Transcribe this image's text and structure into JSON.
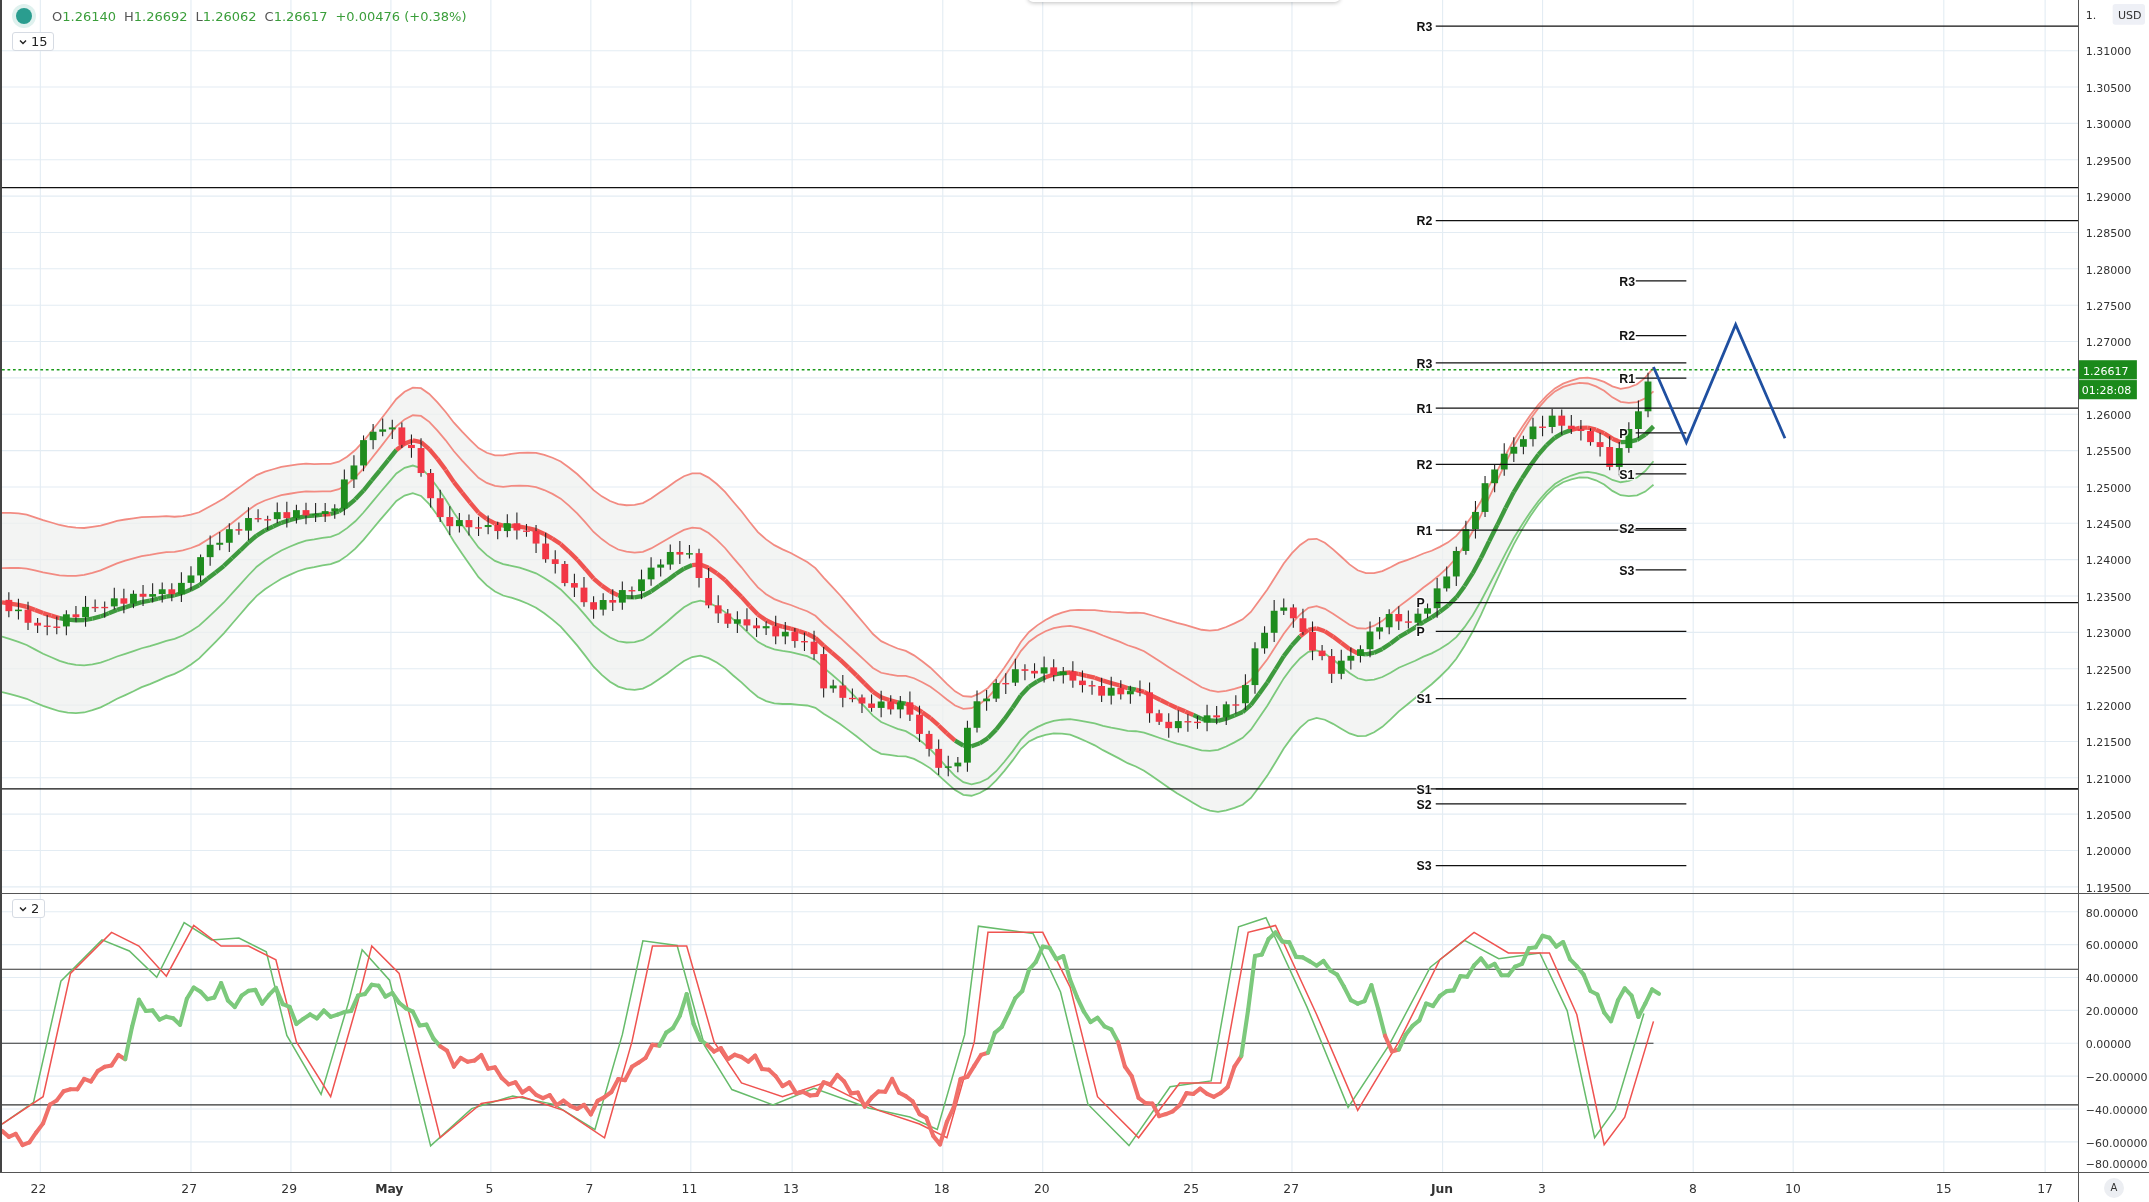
{
  "legend": {
    "ohlc": [
      {
        "label": "O",
        "value": "1.26140"
      },
      {
        "label": "H",
        "value": "1.26692"
      },
      {
        "label": "L",
        "value": "1.26062"
      },
      {
        "label": "C",
        "value": "1.26617"
      }
    ],
    "change": "+0.00476 (+0.38%)"
  },
  "main_pane": {
    "interval_button": "15",
    "pivots": [
      {
        "label": "R3"
      },
      {
        "label": "R2"
      },
      {
        "label": "R3"
      },
      {
        "label": "R2"
      },
      {
        "label": "R3"
      },
      {
        "label": "R1"
      },
      {
        "label": "R1"
      },
      {
        "label": "P"
      },
      {
        "label": "R2"
      },
      {
        "label": "S1"
      },
      {
        "label": "R1"
      },
      {
        "label": "S2"
      },
      {
        "label": "S3"
      },
      {
        "label": "P"
      },
      {
        "label": "P"
      },
      {
        "label": "S1"
      },
      {
        "label": "S1"
      },
      {
        "label": "S2"
      },
      {
        "label": "S3"
      }
    ]
  },
  "price_axis": {
    "currency": "USD",
    "ticks": [
      "1.",
      "1.31000",
      "1.30500",
      "1.30000",
      "1.29500",
      "1.29000",
      "1.28500",
      "1.28000",
      "1.27500",
      "1.27000",
      "1.26000",
      "1.25500",
      "1.25000",
      "1.24500",
      "1.24000",
      "1.23500",
      "1.23000",
      "1.22500",
      "1.22000",
      "1.21500",
      "1.21000",
      "1.20500",
      "1.20000",
      "1.19500"
    ],
    "last_price": "1.26617",
    "countdown": "01:28:08"
  },
  "oscillator_pane": {
    "button": "2",
    "ticks": [
      "80.00000",
      "60.00000",
      "40.00000",
      "20.00000",
      "0.00000",
      "−20.00000",
      "−40.00000",
      "−60.00000",
      "−80.00000"
    ]
  },
  "time_axis": {
    "ticks": [
      {
        "label": "22",
        "bold": false
      },
      {
        "label": "27",
        "bold": false
      },
      {
        "label": "29",
        "bold": false
      },
      {
        "label": "May",
        "bold": true
      },
      {
        "label": "5",
        "bold": false
      },
      {
        "label": "7",
        "bold": false
      },
      {
        "label": "11",
        "bold": false
      },
      {
        "label": "13",
        "bold": false
      },
      {
        "label": "18",
        "bold": false
      },
      {
        "label": "20",
        "bold": false
      },
      {
        "label": "25",
        "bold": false
      },
      {
        "label": "27",
        "bold": false
      },
      {
        "label": "Jun",
        "bold": true
      },
      {
        "label": "3",
        "bold": false
      },
      {
        "label": "8",
        "bold": false
      },
      {
        "label": "10",
        "bold": false
      },
      {
        "label": "15",
        "bold": false
      },
      {
        "label": "17",
        "bold": false
      }
    ]
  },
  "auto_scale_button": "A"
}
